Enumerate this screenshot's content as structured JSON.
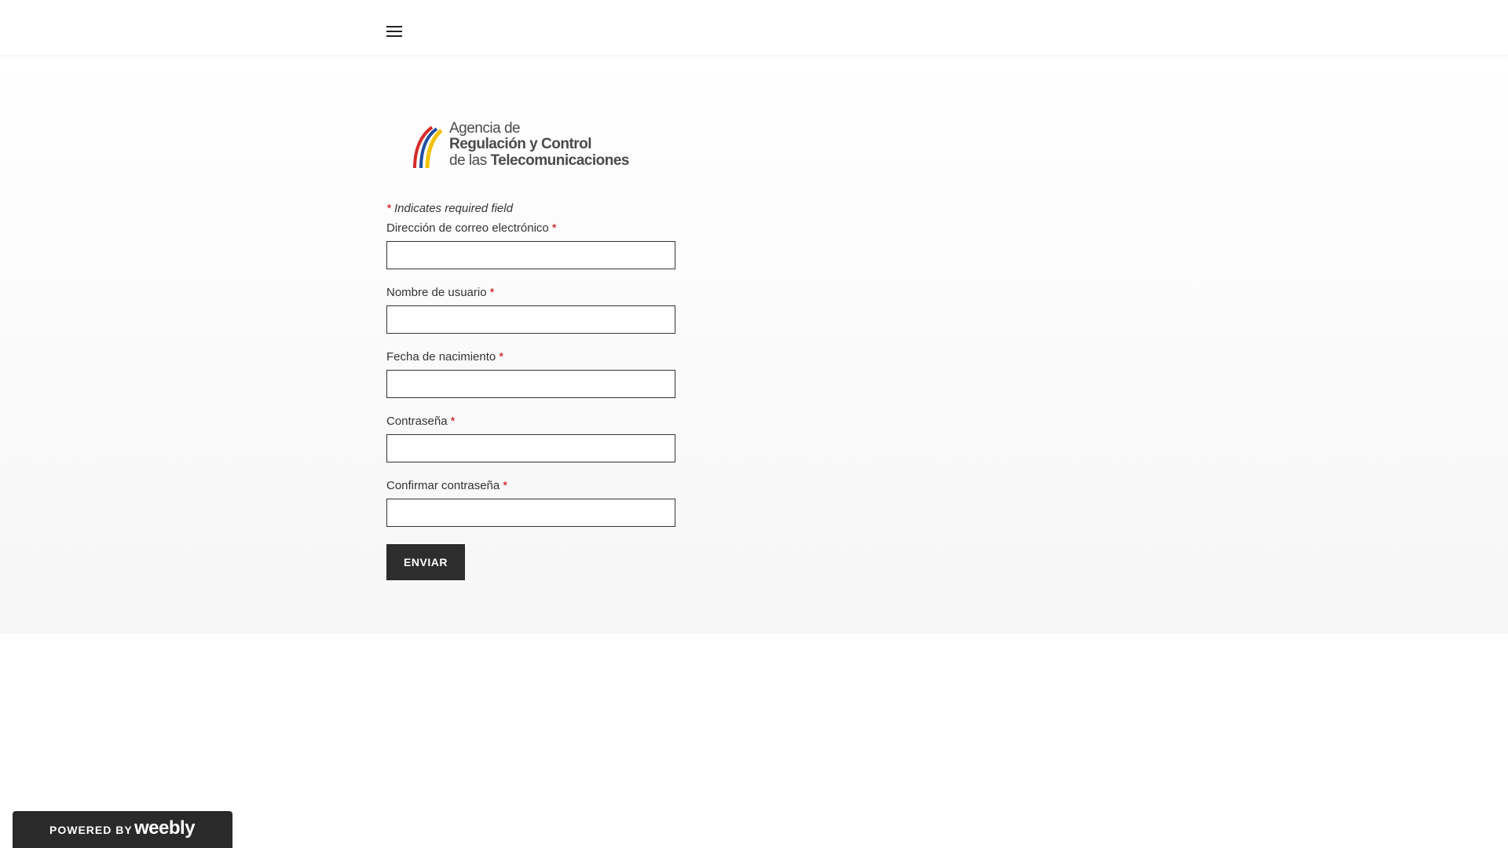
{
  "header": {
    "menu_icon": "hamburger-menu-icon"
  },
  "logo": {
    "line1": "Agencia de",
    "line2": "Regulación y Control",
    "line3_prefix": "de las ",
    "line3_bold": "Telecomunicaciones",
    "colors": [
      "#f2c200",
      "#1f4fa3",
      "#d62b2b"
    ]
  },
  "form": {
    "required_star": "*",
    "required_note": "Indicates required field",
    "fields": [
      {
        "label": "Dirección de correo electrónico",
        "value": "",
        "placeholder": ""
      },
      {
        "label": "Nombre de usuario",
        "value": "",
        "placeholder": ""
      },
      {
        "label": "Fecha de nacimiento",
        "value": "",
        "placeholder": ""
      },
      {
        "label": "Contraseña",
        "value": "",
        "placeholder": ""
      },
      {
        "label": "Confirmar contraseña",
        "value": "",
        "placeholder": ""
      }
    ],
    "submit_label": "ENVIAR"
  },
  "footer": {
    "powered_by": "POWERED BY",
    "brand": "weebly"
  },
  "colors": {
    "accent": "#2d2d2d",
    "required": "#cc0000",
    "badge_bg": "#2a2a2a"
  }
}
